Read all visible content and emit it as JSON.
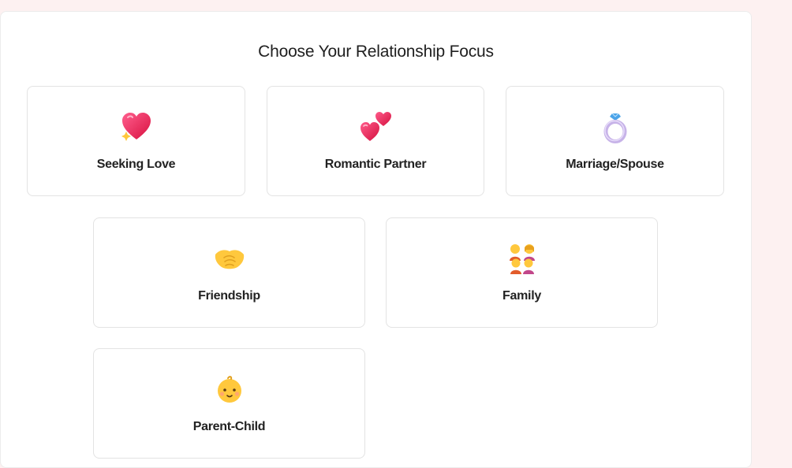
{
  "title": "Choose Your Relationship Focus",
  "options": [
    {
      "label": "Seeking Love",
      "icon": "sparkling-heart-icon"
    },
    {
      "label": "Romantic Partner",
      "icon": "two-hearts-icon"
    },
    {
      "label": "Marriage/Spouse",
      "icon": "ring-icon"
    },
    {
      "label": "Friendship",
      "icon": "handshake-icon"
    },
    {
      "label": "Family",
      "icon": "family-icon"
    },
    {
      "label": "Parent-Child",
      "icon": "baby-icon"
    }
  ],
  "colors": {
    "page_background": "#fdf1f1",
    "panel_background": "#ffffff",
    "card_border": "#e3e3e3",
    "heart_pink": "#ff2d6f",
    "ring_gem": "#4aa3e8",
    "emoji_yellow": "#ffc83d"
  }
}
